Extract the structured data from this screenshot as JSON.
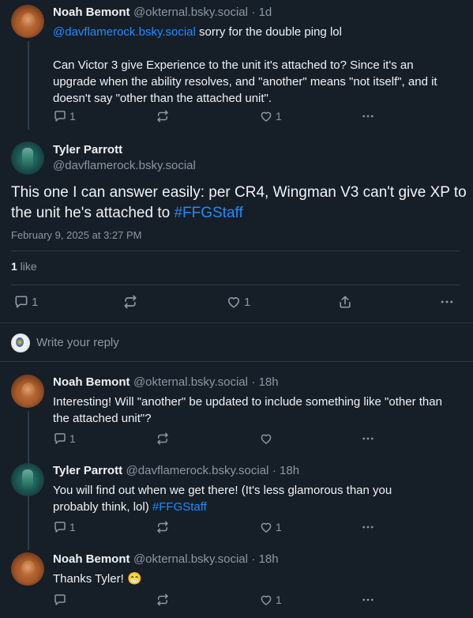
{
  "posts": [
    {
      "author": "Noah Bemont",
      "handle": "@okternal.bsky.social",
      "time": "· 1d",
      "mention": "@davflamerock.bsky.social",
      "text_after_mention": " sorry for the double ping lol",
      "body": "Can Victor 3 give Experience to the unit it's attached to? Since it's an upgrade when the ability resolves, and \"another\" means \"not itself\", and it doesn't say \"other than the attached unit\".",
      "reply_count": "1",
      "like_count": "1"
    }
  ],
  "focus": {
    "author": "Tyler Parrott",
    "handle": "@davflamerock.bsky.social",
    "text": "This one I can answer easily: per CR4, Wingman V3 can't give XP to the unit he's attached to ",
    "hashtag": "#FFGStaff",
    "timestamp": "February 9, 2025 at 3:27 PM",
    "likes_count": "1",
    "likes_label": " like",
    "reply_count": "1",
    "like_count": "1"
  },
  "composer": {
    "placeholder": "Write your reply"
  },
  "replies": [
    {
      "author": "Noah Bemont",
      "handle": "@okternal.bsky.social",
      "time": "· 18h",
      "text": "Interesting! Will \"another\" be updated to include something like \"other than the attached unit\"?",
      "reply_count": "1",
      "like_count": ""
    },
    {
      "author": "Tyler Parrott",
      "handle": "@davflamerock.bsky.social",
      "time": "· 18h",
      "text": "You will find out when we get there! (It's less glamorous than you probably think, lol) ",
      "hashtag": "#FFGStaff",
      "reply_count": "1",
      "like_count": "1"
    },
    {
      "author": "Noah Bemont",
      "handle": "@okternal.bsky.social",
      "time": "· 18h",
      "text": "Thanks Tyler! ",
      "emoji": "😁",
      "reply_count": "",
      "like_count": "1"
    }
  ],
  "icons": {
    "reply": "reply-icon",
    "repost": "repost-icon",
    "like": "heart-icon",
    "share": "share-icon",
    "more": "more-icon"
  },
  "colors": {
    "background": "#161e27",
    "text": "#f1f3f5",
    "muted": "#8b98a5",
    "link": "#208bfe",
    "divider": "#2e3a47"
  }
}
